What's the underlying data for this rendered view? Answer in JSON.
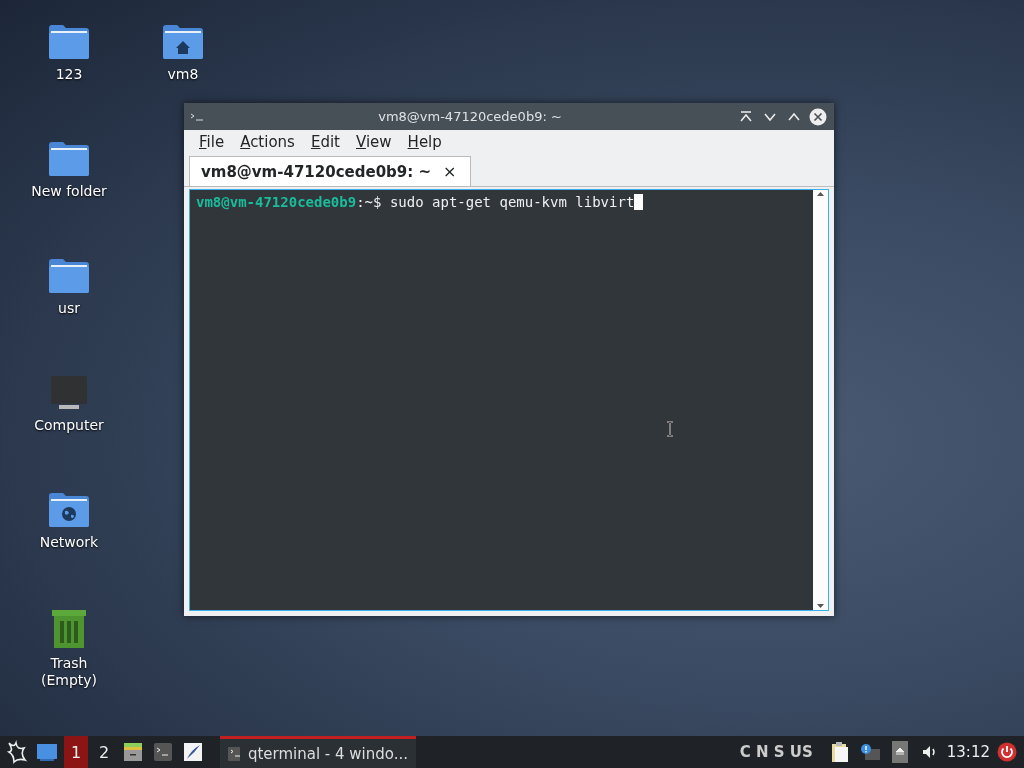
{
  "desktop_icons": [
    {
      "kind": "folder",
      "label": "123"
    },
    {
      "kind": "home-folder",
      "label": "vm8"
    },
    {
      "kind": "folder",
      "label": "New folder"
    },
    {
      "kind": "folder",
      "label": "usr"
    },
    {
      "kind": "computer",
      "label": "Computer"
    },
    {
      "kind": "network",
      "label": "Network"
    },
    {
      "kind": "trash",
      "label": "Trash\n(Empty)"
    }
  ],
  "window": {
    "title": "vm8@vm-47120cede0b9: ~",
    "menu": [
      "File",
      "Actions",
      "Edit",
      "View",
      "Help"
    ],
    "tabs": [
      {
        "label": "vm8@vm-47120cede0b9: ~",
        "selected": true,
        "close": "×"
      }
    ],
    "terminal": {
      "user_host": "vm8@vm-47120cede0b9",
      "path": ":~",
      "prompt": "$",
      "command": " sudo apt-get qemu-kvm libvirt"
    }
  },
  "taskbar": {
    "workspaces": [
      {
        "label": "1",
        "selected": true
      },
      {
        "label": "2",
        "selected": false
      }
    ],
    "tasks": [
      {
        "label": "qterminal - 4 windo...",
        "active": true
      }
    ],
    "keyboard": "C N S US",
    "clock": "13:12"
  }
}
